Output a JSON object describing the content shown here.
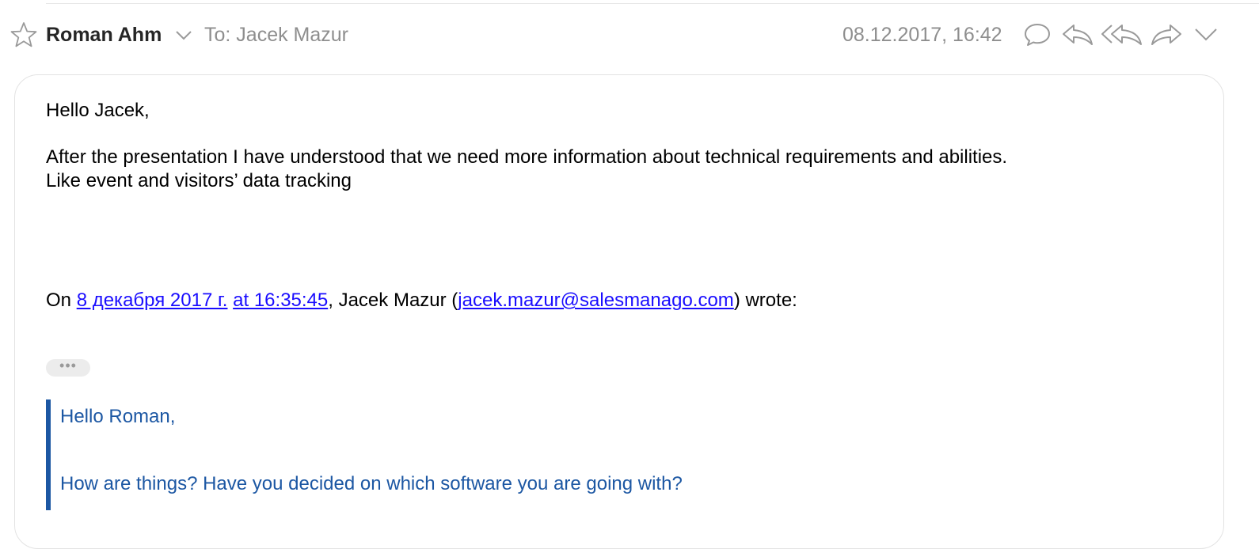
{
  "header": {
    "sender": "Roman Ahm",
    "recipient": "To: Jacek Mazur",
    "date": "08.12.2017, 16:42",
    "icons": [
      "star-icon",
      "chevron-down-icon",
      "comment-icon",
      "reply-icon",
      "reply-all-icon",
      "forward-icon",
      "chevron-down-icon"
    ]
  },
  "message": {
    "greeting": "Hello Jacek,",
    "line1": "After the presentation I have understood that we need more information about technical requirements and abilities.",
    "line2": "Like event and visitors’ data tracking",
    "attribution": {
      "prefix": "On ",
      "date_link": "8 декабря 2017 г.",
      "space": " ",
      "time_link": "at 16:35:45",
      "middle": ", Jacek Mazur (",
      "email_link": "jacek.mazur@salesmanago.com",
      "suffix": ") wrote:"
    },
    "expand_label": "•••"
  },
  "quote": {
    "greeting": "Hello Roman,",
    "line1": "How are things? Have you decided on which software you are going with?"
  },
  "colors": {
    "link": "#1a0dff",
    "quote": "#1c57a3",
    "meta": "#8e8e8e"
  }
}
